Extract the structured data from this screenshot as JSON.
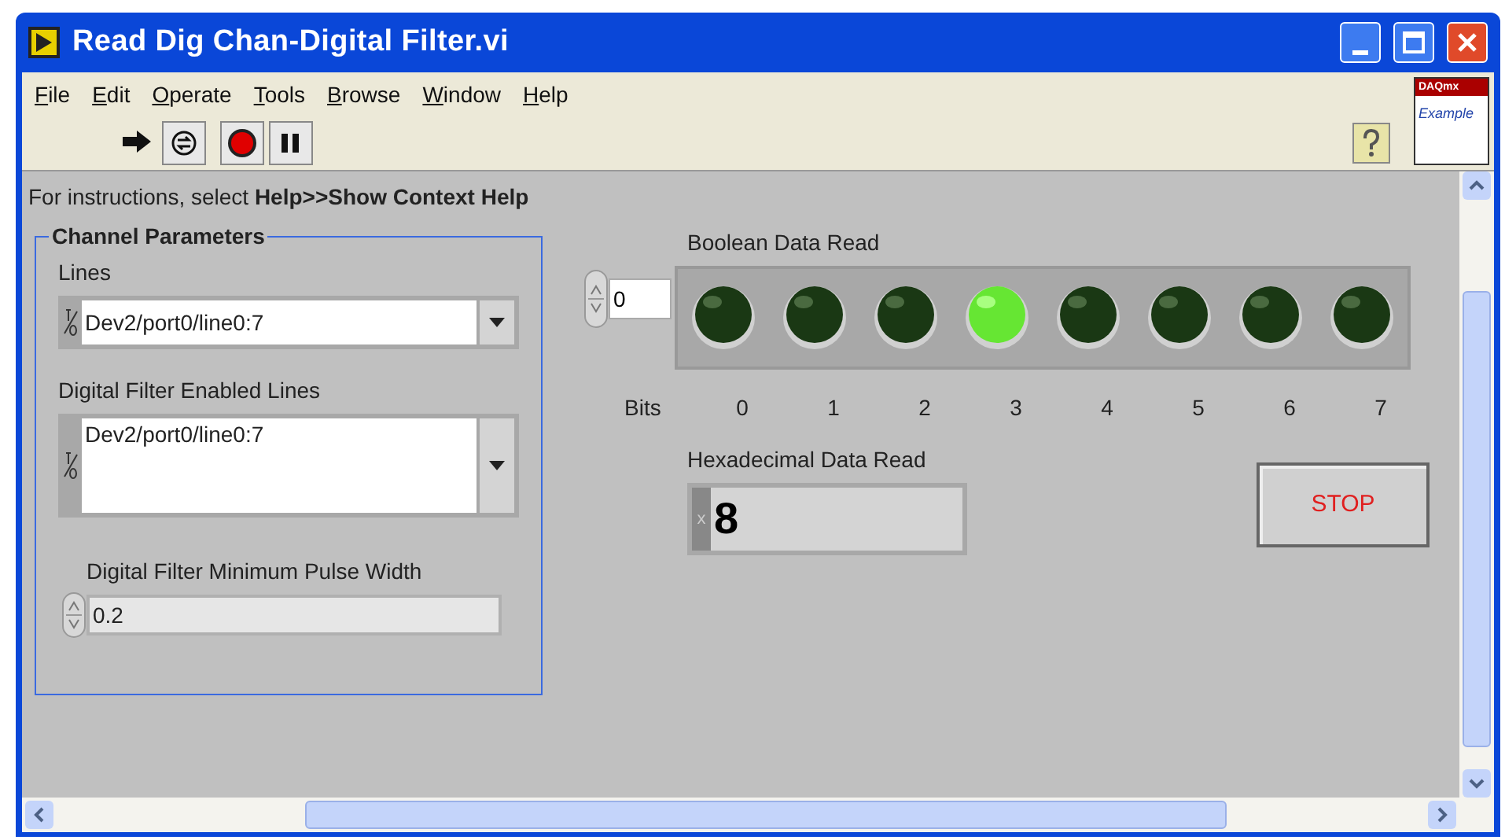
{
  "window": {
    "title": "Read Dig Chan-Digital Filter.vi"
  },
  "menu": [
    "File",
    "Edit",
    "Operate",
    "Tools",
    "Browse",
    "Window",
    "Help"
  ],
  "logo": {
    "line_1": "DAQmx",
    "line_2": "Example"
  },
  "instructions": "For instructions, select **Help>>Show Context Help**",
  "channel_parameters": {
    "title": "Channel Parameters",
    "lines": {
      "label": "Lines",
      "value": "Dev2/port0/line0:7"
    },
    "filter_enabled_lines": {
      "label": "Digital Filter Enabled Lines",
      "value": "Dev2/port0/line0:7"
    },
    "minimum_pulse_width": {
      "label": "Digital Filter Minimum Pulse Width",
      "value": "0.2"
    }
  },
  "boolean_data": {
    "title": "Boolean Data Read",
    "index": "0",
    "bits_label": "Bits",
    "leds": [
      {
        "label": "0",
        "on": false
      },
      {
        "label": "1",
        "on": false
      },
      {
        "label": "2",
        "on": false
      },
      {
        "label": "3",
        "on": true
      },
      {
        "label": "4",
        "on": false
      },
      {
        "label": "5",
        "on": false
      },
      {
        "label": "6",
        "on": false
      },
      {
        "label": "7",
        "on": false
      }
    ]
  },
  "hex_data": {
    "label": "Hexadecimal Data Read",
    "radix": "x",
    "value": "8"
  },
  "stop_button": "STOP"
}
